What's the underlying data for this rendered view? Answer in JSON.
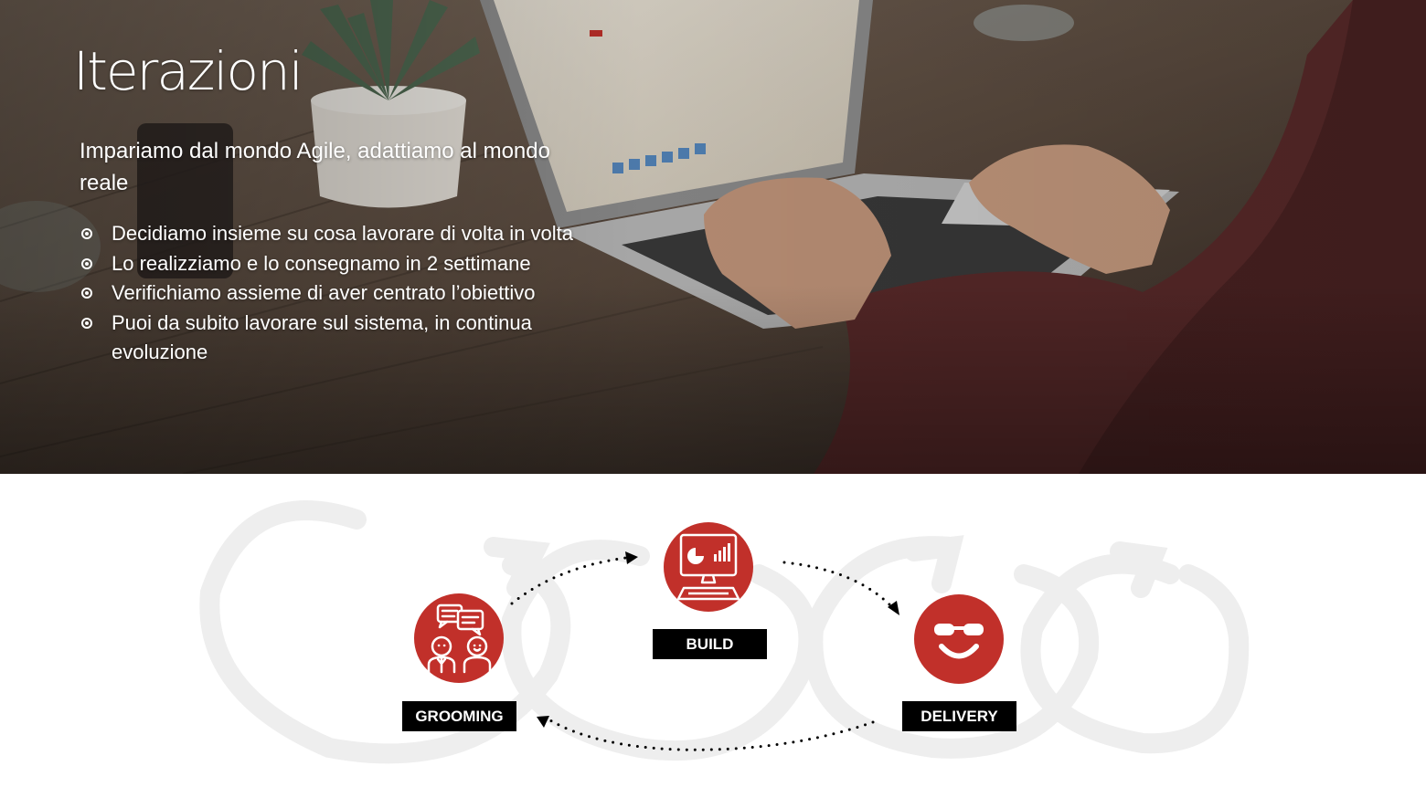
{
  "slide": {
    "title": "Iterazioni",
    "subtitle": "Impariamo dal mondo Agile, adattiamo al mondo reale",
    "bullets": [
      "Decidiamo insieme su cosa lavorare di volta in volta",
      "Lo realizziamo e lo consegnamo in 2 settimane",
      "Verifichiamo assieme di aver centrato l’obiettivo",
      "Puoi da subito lavorare sul sistema, in continua evoluzione"
    ]
  },
  "cycle": {
    "steps": [
      {
        "label": "GROOMING",
        "icon": "people-chat-icon"
      },
      {
        "label": "BUILD",
        "icon": "computer-dashboard-icon"
      },
      {
        "label": "DELIVERY",
        "icon": "sunglasses-smiley-icon"
      }
    ],
    "accent_color": "#c1302a",
    "label_bg_color": "#000000"
  }
}
